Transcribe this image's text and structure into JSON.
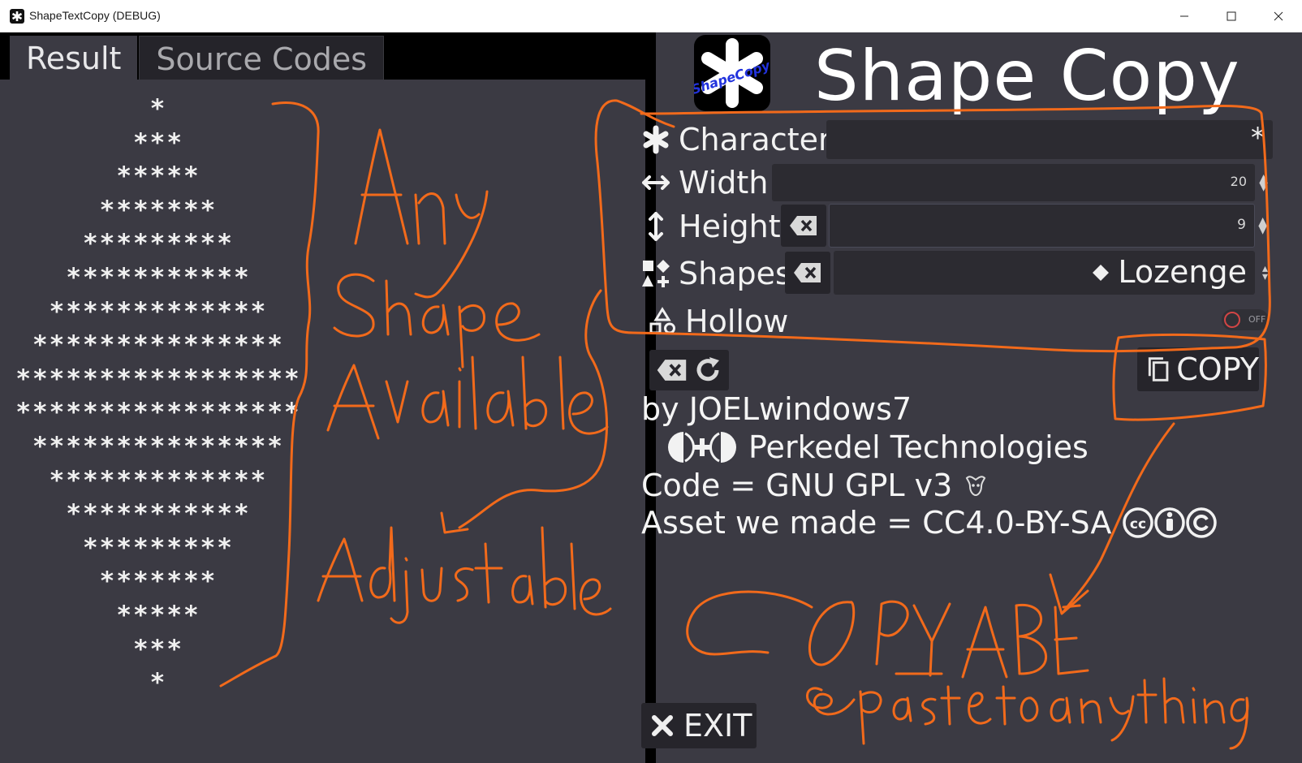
{
  "window": {
    "title": "ShapeTextCopy (DEBUG)"
  },
  "tabs": [
    {
      "label": "Result",
      "active": true
    },
    {
      "label": "Source Codes",
      "active": false
    }
  ],
  "result": {
    "shape_text": "*\n***\n*****\n*******\n*********\n***********\n*************\n***************\n*****************\n*****************\n***************\n*************\n***********\n*********\n*******\n*****\n***\n*"
  },
  "header": {
    "title": "Shape Copy",
    "logo_text": "ShapeCopy"
  },
  "form": {
    "character": {
      "label": "Character",
      "value": "*"
    },
    "width": {
      "label": "Width",
      "value": "20"
    },
    "height": {
      "label": "Height",
      "value": "9"
    },
    "shapes": {
      "label": "Shapes",
      "selected": "Lozenge"
    },
    "hollow": {
      "label": "Hollow",
      "state": "OFF",
      "on": false
    }
  },
  "actions": {
    "copy_label": "COPY",
    "exit_label": "EXIT"
  },
  "credits": {
    "author": "by JOELwindows7",
    "company": "Perkedel Technologies",
    "code_license": "Code = GNU GPL v3",
    "asset_license": "Asset we made = CC4.0-BY-SA"
  },
  "colors": {
    "annotation": "#f26a1b",
    "panel": "#3b3a43",
    "field": "#2c2b31"
  }
}
